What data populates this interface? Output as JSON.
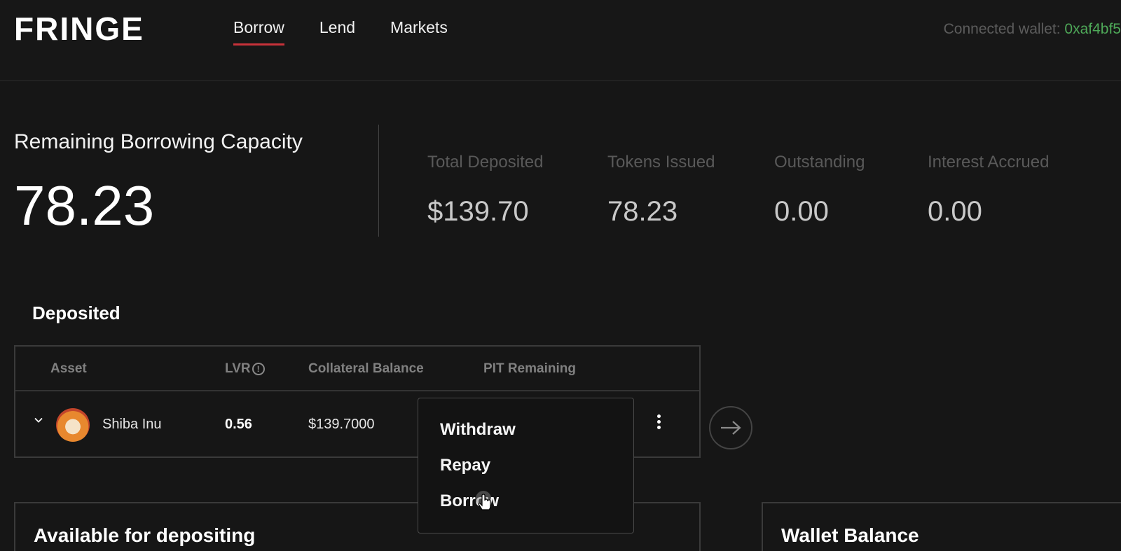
{
  "header": {
    "logo": "FRINGE",
    "nav": [
      {
        "label": "Borrow",
        "active": true
      },
      {
        "label": "Lend",
        "active": false
      },
      {
        "label": "Markets",
        "active": false
      }
    ],
    "wallet_label": "Connected wallet:",
    "wallet_address": "0xaf4bf5"
  },
  "summary": {
    "capacity_title": "Remaining Borrowing Capacity",
    "capacity_value": "78.23",
    "stats": [
      {
        "label": "Total Deposited",
        "value": "$139.70"
      },
      {
        "label": "Tokens Issued",
        "value": "78.23"
      },
      {
        "label": "Outstanding",
        "value": "0.00"
      },
      {
        "label": "Interest Accrued",
        "value": "0.00"
      }
    ]
  },
  "deposited": {
    "title": "Deposited",
    "columns": [
      "Asset",
      "LVR",
      "Collateral Balance",
      "PIT Remaining"
    ],
    "lvr_info_glyph": "!",
    "rows": [
      {
        "asset": "Shiba Inu",
        "lvr": "0.56",
        "collateral_balance": "$139.7000",
        "pit_remaining": ""
      }
    ]
  },
  "row_menu": {
    "items": [
      "Withdraw",
      "Repay",
      "Borrow"
    ]
  },
  "panels": {
    "available_title": "Available for depositing",
    "wallet_title": "Wallet Balance"
  },
  "colors": {
    "accent": "#c8323a",
    "wallet_address": "#4ea858",
    "background": "#161616"
  }
}
